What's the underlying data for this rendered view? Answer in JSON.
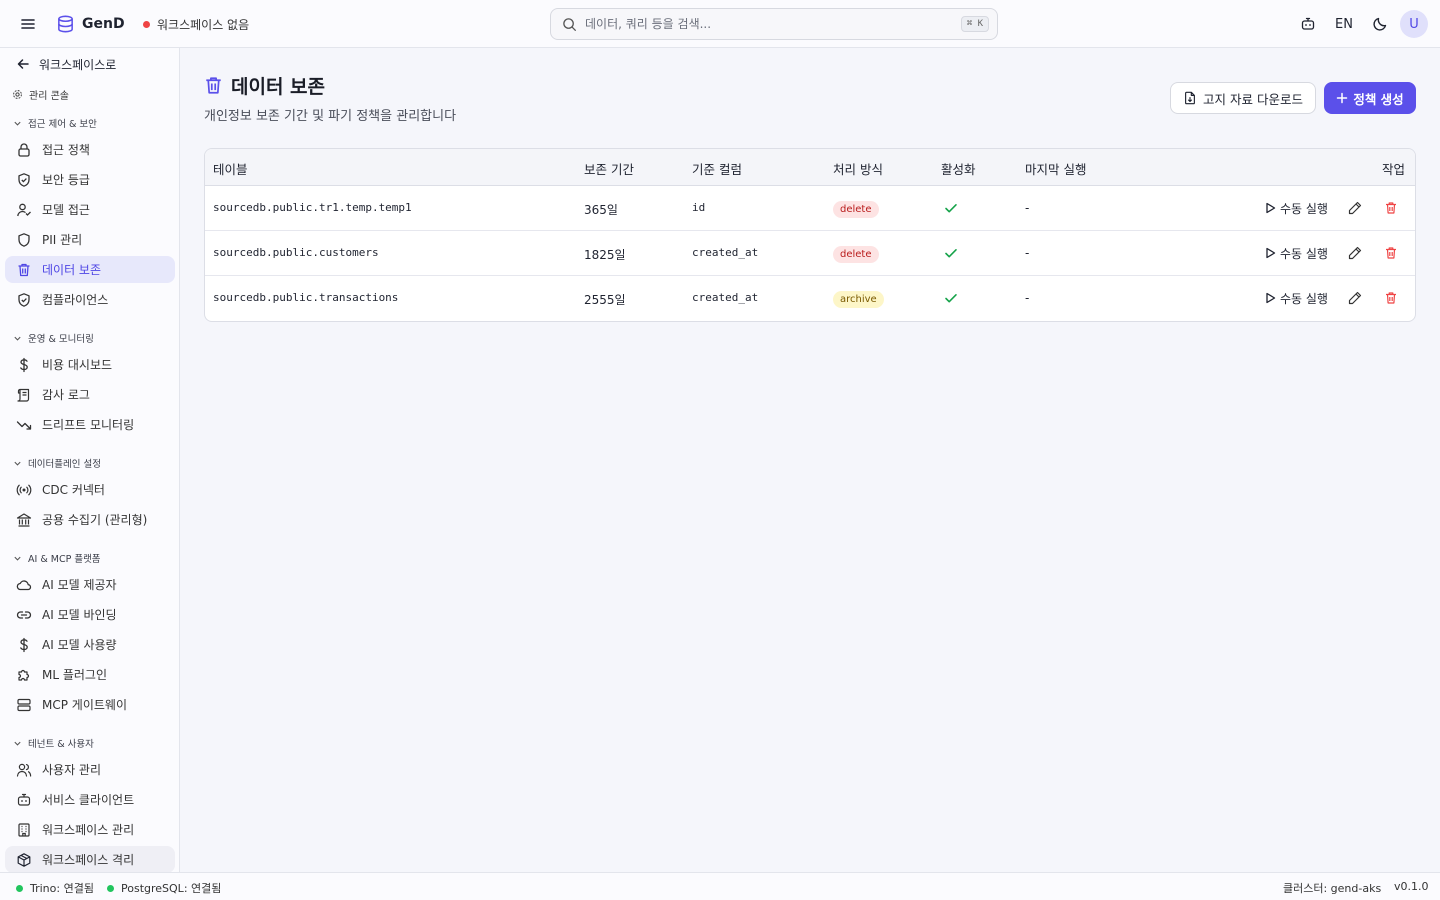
{
  "app": {
    "name": "GenD",
    "workspace_status": "워크스페이스 없음",
    "search_placeholder": "데이터, 쿼리 등을 검색...",
    "search_shortcut": "⌘ K",
    "language": "EN",
    "avatar_initial": "U"
  },
  "sidebar": {
    "back_label": "워크스페이스로",
    "console_label": "관리 콘솔",
    "groups": [
      {
        "title": "접근 제어 & 보안",
        "items": [
          {
            "label": "접근 정책",
            "icon": "lock-icon"
          },
          {
            "label": "보안 등급",
            "icon": "shield-check-icon"
          },
          {
            "label": "모델 접근",
            "icon": "user-check-icon"
          },
          {
            "label": "PII 관리",
            "icon": "shield-icon"
          },
          {
            "label": "데이터 보존",
            "icon": "trash-icon",
            "active": true
          },
          {
            "label": "컴플라이언스",
            "icon": "shield-check-icon"
          }
        ]
      },
      {
        "title": "운영 & 모니터링",
        "items": [
          {
            "label": "비용 대시보드",
            "icon": "dollar-icon"
          },
          {
            "label": "감사 로그",
            "icon": "scroll-icon"
          },
          {
            "label": "드리프트 모니터링",
            "icon": "trend-down-icon"
          }
        ]
      },
      {
        "title": "데이터플레인 설정",
        "items": [
          {
            "label": "CDC 커넥터",
            "icon": "radio-icon"
          },
          {
            "label": "공용 수집기 (관리형)",
            "icon": "bank-icon"
          }
        ]
      },
      {
        "title": "AI & MCP 플랫폼",
        "items": [
          {
            "label": "AI 모델 제공자",
            "icon": "cloud-icon"
          },
          {
            "label": "AI 모델 바인딩",
            "icon": "link-icon"
          },
          {
            "label": "AI 모델 사용량",
            "icon": "dollar-icon"
          },
          {
            "label": "ML 플러그인",
            "icon": "puzzle-icon"
          },
          {
            "label": "MCP 게이트웨이",
            "icon": "server-icon"
          }
        ]
      },
      {
        "title": "테넌트 & 사용자",
        "items": [
          {
            "label": "사용자 관리",
            "icon": "users-icon"
          },
          {
            "label": "서비스 클라이언트",
            "icon": "bot-icon"
          },
          {
            "label": "워크스페이스 관리",
            "icon": "building-icon"
          },
          {
            "label": "워크스페이스 격리",
            "icon": "box-icon"
          }
        ]
      }
    ]
  },
  "page": {
    "title": "데이터 보존",
    "subtitle": "개인정보 보존 기간 및 파기 정책을 관리합니다",
    "download_label": "고지 자료 다운로드",
    "create_label": "정책 생성"
  },
  "table": {
    "columns": [
      "테이블",
      "보존 기간",
      "기준 컬럼",
      "처리 방식",
      "활성화",
      "마지막 실행",
      "작업"
    ],
    "run_label": "수동 실행",
    "rows": [
      {
        "table": "sourcedb.public.tr1.temp.temp1",
        "period": "365일",
        "column": "id",
        "method": "delete",
        "active": true,
        "last_run": "-"
      },
      {
        "table": "sourcedb.public.customers",
        "period": "1825일",
        "column": "created_at",
        "method": "delete",
        "active": true,
        "last_run": "-"
      },
      {
        "table": "sourcedb.public.transactions",
        "period": "2555일",
        "column": "created_at",
        "method": "archive",
        "active": true,
        "last_run": "-"
      }
    ]
  },
  "status": {
    "trino": "Trino: 연결됨",
    "postgres": "PostgreSQL: 연결됨",
    "cluster": "클러스터: gend-aks",
    "version": "v0.1.0"
  },
  "colors": {
    "accent": "#5b50ea",
    "success": "#16a34a",
    "danger": "#ef4444"
  }
}
